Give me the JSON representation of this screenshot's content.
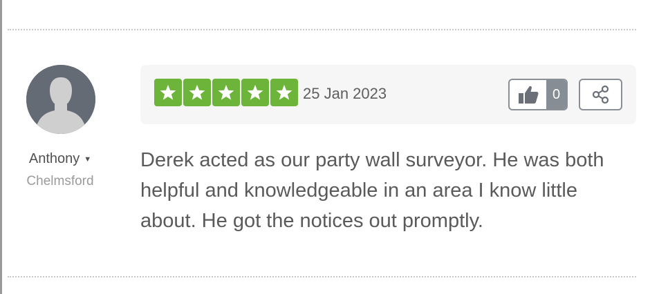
{
  "reviewer": {
    "name": "Anthony",
    "location": "Chelmsford"
  },
  "review": {
    "rating": 5,
    "max_rating": 5,
    "date": "25 Jan 2023",
    "text": "Derek acted as our party wall surveyor. He was both helpful and knowledgeable in an area I know little about. He got the notices out promptly.",
    "like_count": "0"
  },
  "icons": {
    "avatar": "person-silhouette-icon",
    "star": "star-icon",
    "like": "thumbs-up-icon",
    "share": "share-icon",
    "caret": "caret-down-icon"
  },
  "colors": {
    "star_background": "#6cb43a",
    "avatar_background": "#646b75",
    "like_count_background": "#878d95"
  }
}
